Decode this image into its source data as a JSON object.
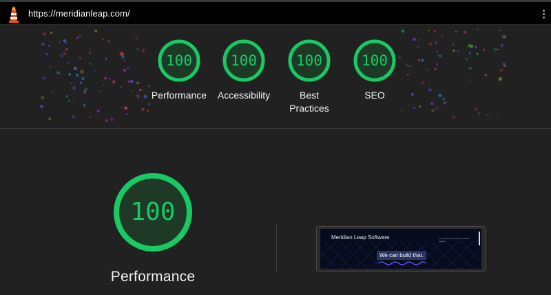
{
  "topbar": {
    "url": "https://meridianleap.com/",
    "logo_icon": "lighthouse-icon",
    "menu_icon": "kebab-menu-icon"
  },
  "scores": [
    {
      "label": "Performance",
      "score": "100"
    },
    {
      "label": "Accessibility",
      "score": "100"
    },
    {
      "label": "Best Practices",
      "score": "100"
    },
    {
      "label": "SEO",
      "score": "100"
    }
  ],
  "performance": {
    "title": "Performance",
    "score": "100"
  },
  "screenshot": {
    "brand": "Meridian Leap Software",
    "nav": "Home  Services  Contact us  About  support",
    "cta": "We can build that."
  },
  "colors": {
    "pass": "#18c964",
    "pass_fill": "#1e3a27",
    "background": "#212121"
  }
}
